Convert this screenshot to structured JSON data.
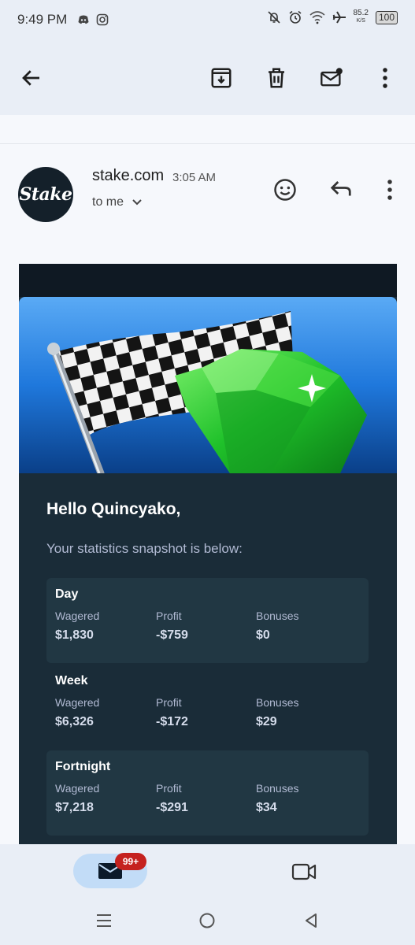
{
  "status_bar": {
    "time": "9:49 PM",
    "net_rate": "85.2",
    "net_unit": "K/S",
    "battery": "100"
  },
  "toolbar": {
    "back_icon": "arrow-back-icon",
    "archive_icon": "archive-icon",
    "delete_icon": "trash-icon",
    "mark_unread_icon": "mail-unread-icon",
    "more_icon": "more-vert-icon"
  },
  "message": {
    "avatar_text": "Stake",
    "sender": "stake.com",
    "time": "3:05 AM",
    "recipient": "to me"
  },
  "email": {
    "greeting": "Hello Quincyako,",
    "intro": "Your statistics snapshot is below:",
    "columns": [
      "Wagered",
      "Profit",
      "Bonuses"
    ],
    "stats": [
      {
        "period": "Day",
        "wagered": "$1,830",
        "profit": "-$759",
        "bonuses": "$0"
      },
      {
        "period": "Week",
        "wagered": "$6,326",
        "profit": "-$172",
        "bonuses": "$29"
      },
      {
        "period": "Fortnight",
        "wagered": "$7,218",
        "profit": "-$291",
        "bonuses": "$34"
      }
    ]
  },
  "bottom_nav": {
    "mail_badge": "99+",
    "mail_icon": "mail-icon",
    "meet_icon": "videocam-icon"
  },
  "colors": {
    "email_bg": "#1a2c38",
    "stat_box": "#213743",
    "badge": "#c5221f"
  }
}
